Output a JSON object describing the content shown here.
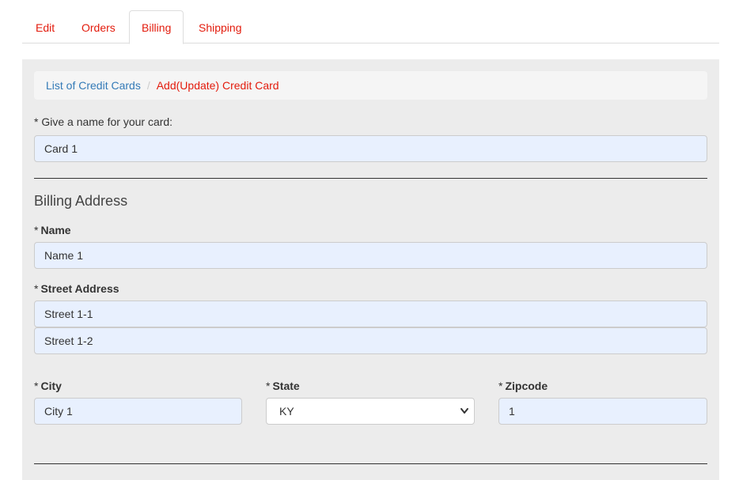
{
  "tabs": [
    {
      "label": "Edit",
      "active": false
    },
    {
      "label": "Orders",
      "active": false
    },
    {
      "label": "Billing",
      "active": true
    },
    {
      "label": "Shipping",
      "active": false
    }
  ],
  "breadcrumb": {
    "link": "List of Credit Cards",
    "separator": "/",
    "current": "Add(Update) Credit Card"
  },
  "card": {
    "name_label": "* Give a name for your card:",
    "name_value": "Card 1"
  },
  "billing": {
    "title": "Billing Address",
    "required_mark": "*",
    "name_label": "Name",
    "name_value": "Name 1",
    "street_label": "Street Address",
    "street1_value": "Street 1-1",
    "street2_value": "Street 1-2",
    "city_label": "City",
    "city_value": "City 1",
    "state_label": "State",
    "state_value": "KY",
    "zip_label": "Zipcode",
    "zip_value": "1"
  },
  "colors": {
    "tab_text": "#e31b0c",
    "link": "#337ab7",
    "input_bg": "#e8f0fe",
    "panel_bg": "#ececec"
  }
}
